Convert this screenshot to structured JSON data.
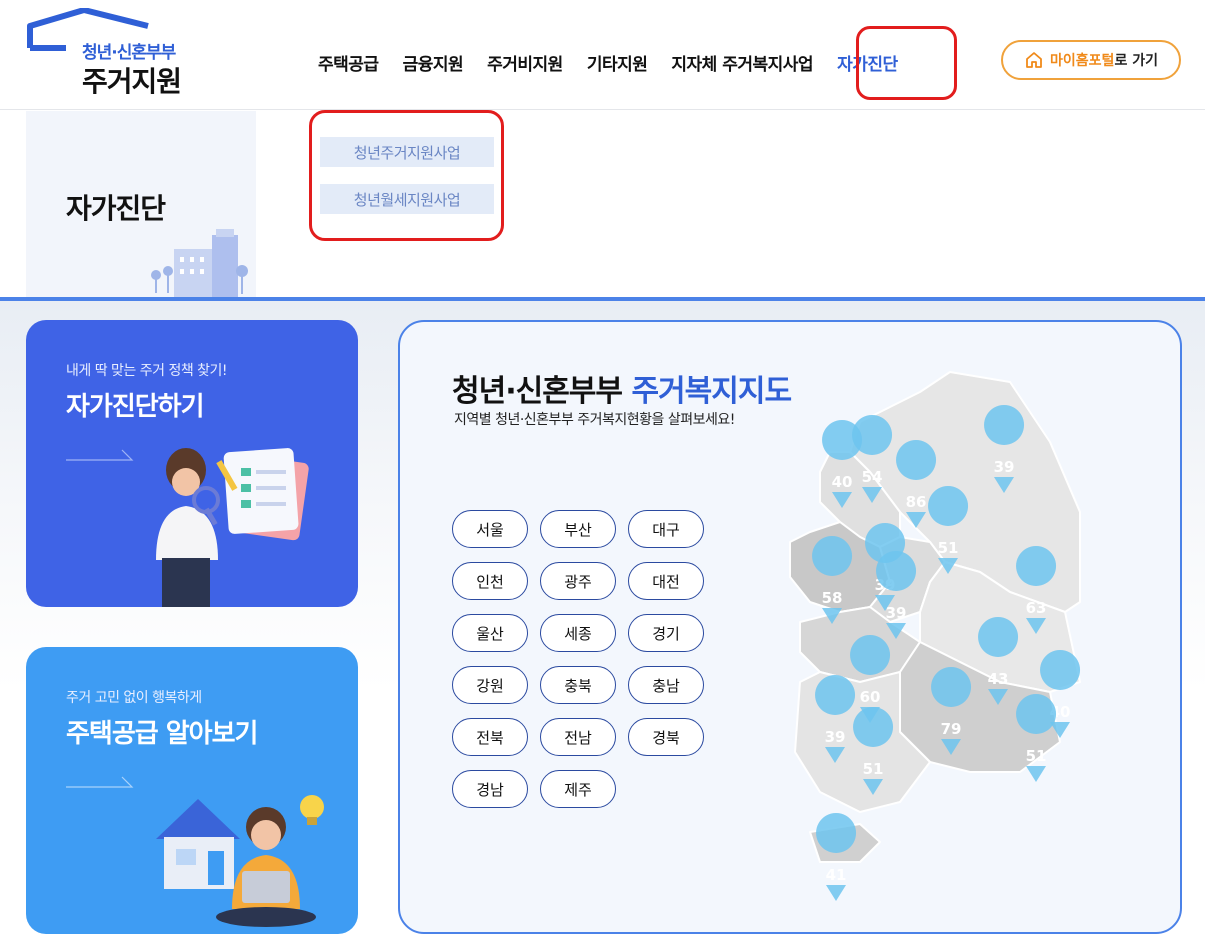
{
  "header": {
    "logo_line1": "청년·신혼부부",
    "logo_line2": "주거지원",
    "nav": [
      {
        "label": "주택공급"
      },
      {
        "label": "금융지원"
      },
      {
        "label": "주거비지원"
      },
      {
        "label": "기타지원"
      },
      {
        "label": "지자체 주거복지사업"
      },
      {
        "label": "자가진단"
      }
    ],
    "myportal_highlight": "마이홈포털",
    "myportal_rest": "로 가기"
  },
  "dropdown": {
    "title": "자가진단",
    "items": [
      "청년주거지원사업",
      "청년월세지원사업"
    ]
  },
  "cards": [
    {
      "subtitle": "내게 딱 맞는 주거 정책 찾기!",
      "title": "자가진단하기"
    },
    {
      "subtitle": "주거 고민 없이 행복하게",
      "title": "주택공급 알아보기"
    }
  ],
  "map": {
    "title_black": "청년·신혼부부 ",
    "title_blue": "주거복지지도",
    "subtitle": "지역별 청년·신혼부부 주거복지현황을 살펴보세요!",
    "regions": [
      "서울",
      "부산",
      "대구",
      "인천",
      "광주",
      "대전",
      "울산",
      "세종",
      "경기",
      "강원",
      "충북",
      "충남",
      "전북",
      "전남",
      "경북",
      "경남",
      "제주"
    ],
    "pins": [
      "40",
      "54",
      "39",
      "86",
      "51",
      "58",
      "39",
      "39",
      "63",
      "43",
      "60",
      "40",
      "79",
      "39",
      "51",
      "51",
      "41"
    ]
  }
}
